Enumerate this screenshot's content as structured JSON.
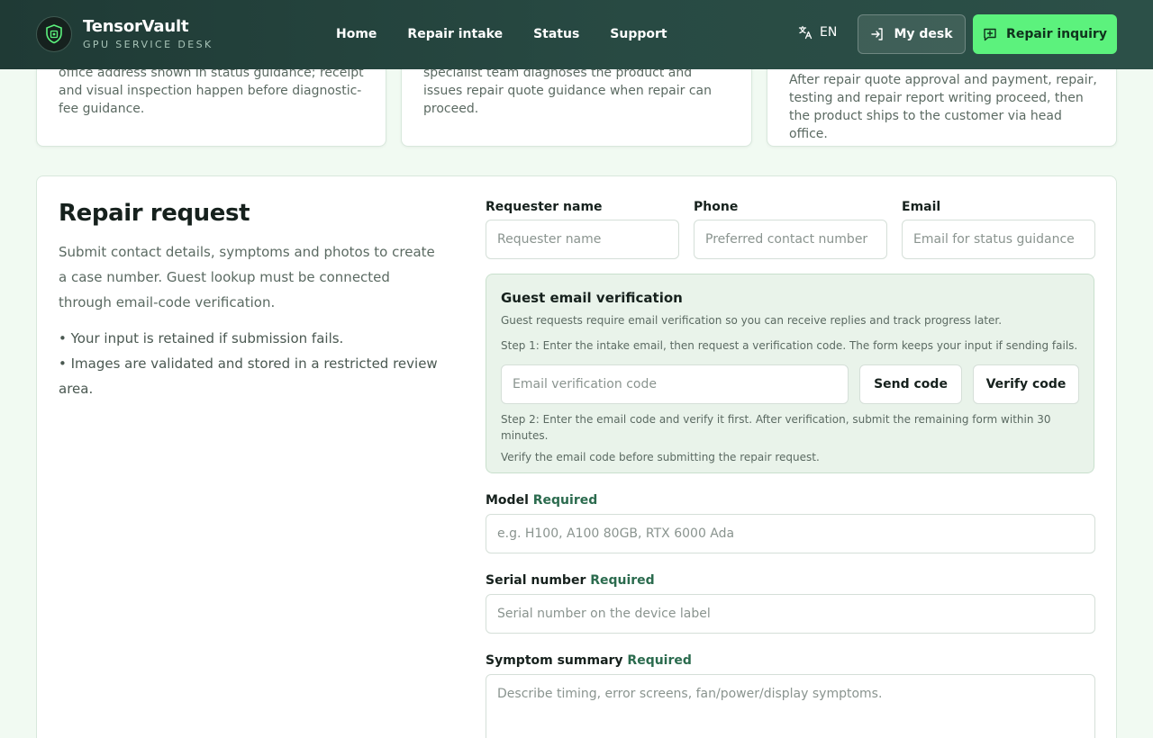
{
  "header": {
    "brand_name": "TensorVault",
    "brand_sub": "GPU SERVICE DESK",
    "nav": [
      "Home",
      "Repair intake",
      "Status",
      "Support"
    ],
    "language": "EN",
    "my_desk": "My desk",
    "repair_inquiry": "Repair inquiry",
    "accent_color": "#5cf27d",
    "header_color": "#1f3a35"
  },
  "steps": [
    {
      "text": "office address shown in status guidance; receipt and visual inspection happen before diagnostic-fee guidance."
    },
    {
      "text": "specialist team diagnoses the product and issues repair quote guidance when repair can proceed."
    },
    {
      "text": "After repair quote approval and payment, repair, testing and repair report writing proceed, then the product ships to the customer via head office."
    }
  ],
  "repair": {
    "title": "Repair request",
    "description": "Submit contact details, symptoms and photos to create a case number. Guest lookup must be connected through email-code verification.",
    "bullets": [
      "• Your input is retained if submission fails.",
      "• Images are validated and stored in a restricted review area."
    ],
    "fields": {
      "name": {
        "label": "Requester name",
        "placeholder": "Requester name"
      },
      "phone": {
        "label": "Phone",
        "placeholder": "Preferred contact number"
      },
      "email": {
        "label": "Email",
        "placeholder": "Email for status guidance"
      }
    },
    "verification": {
      "title": "Guest email verification",
      "note": "Guest requests require email verification so you can receive replies and track progress later.",
      "step1": "Step 1: Enter the intake email, then request a verification code. The form keeps your input if sending fails.",
      "code_placeholder": "Email verification code",
      "send_code": "Send code",
      "verify_code": "Verify code",
      "step2": "Step 2: Enter the email code and verify it first. After verification, submit the remaining form within 30 minutes.",
      "hint": "Verify the email code before submitting the repair request."
    },
    "required_text": "Required",
    "model": {
      "label": "Model",
      "placeholder": "e.g. H100, A100 80GB, RTX 6000 Ada"
    },
    "serial": {
      "label": "Serial number",
      "placeholder": "Serial number on the device label"
    },
    "symptom": {
      "label": "Symptom summary",
      "placeholder": "Describe timing, error screens, fan/power/display symptoms."
    }
  }
}
